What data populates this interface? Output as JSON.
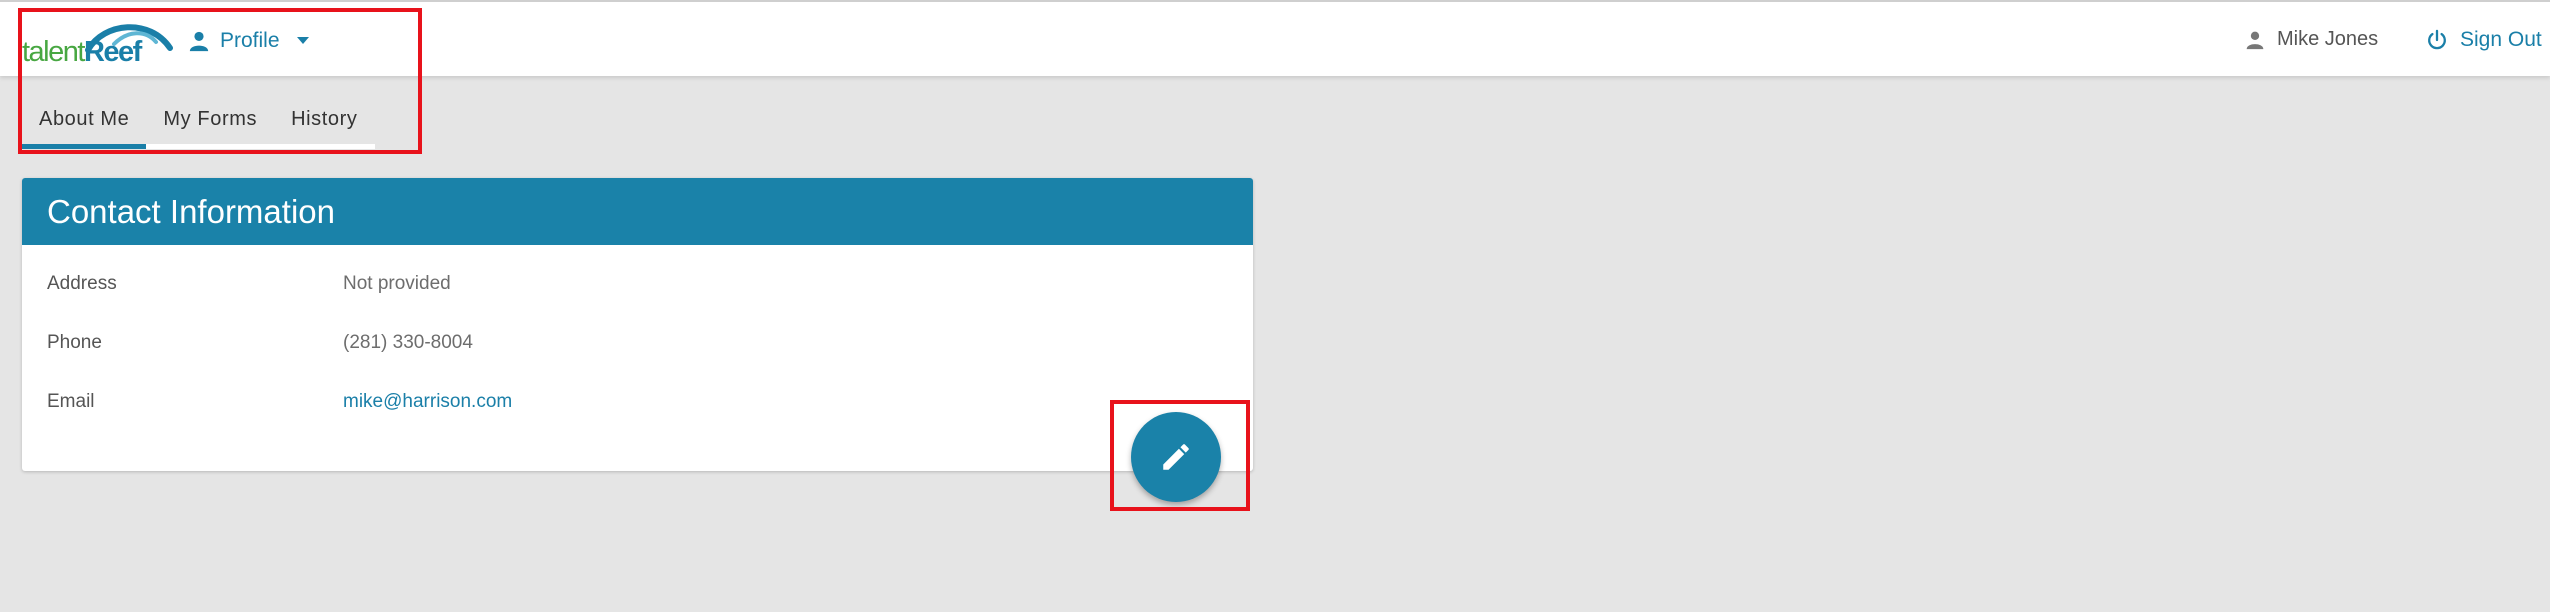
{
  "app": {
    "logo_text_part1": "talent",
    "logo_text_part2": "Reef",
    "brand_color": "#1a7fa8",
    "logo_green": "#48a742"
  },
  "header": {
    "profile_menu_label": "Profile",
    "profile_icon": "user-icon",
    "caret_icon": "caret-down-icon",
    "user_name": "Mike Jones",
    "sign_out_label": "Sign Out",
    "sign_out_icon": "power-icon"
  },
  "tabs": [
    {
      "label": "About Me",
      "active": true
    },
    {
      "label": "My Forms",
      "active": false
    },
    {
      "label": "History",
      "active": false
    }
  ],
  "contact_card": {
    "title": "Contact Information",
    "rows": [
      {
        "label": "Address",
        "value": "Not provided"
      },
      {
        "label": "Phone",
        "value": "(281) 330-8004"
      },
      {
        "label": "Email",
        "value": "mike@harrison.com"
      }
    ]
  },
  "edit_button": {
    "icon": "pencil-icon"
  },
  "highlight_color": "#e8121b"
}
